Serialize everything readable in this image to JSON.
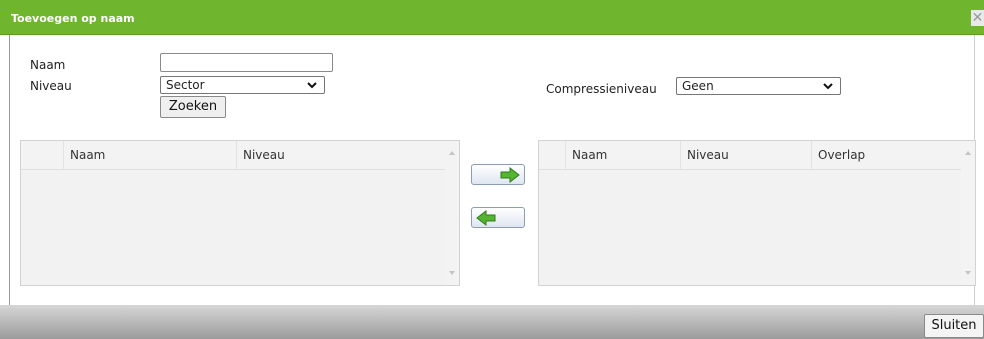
{
  "dialog": {
    "title": "Toevoegen op naam",
    "close_symbol": "✕",
    "close_button_label": "Sluiten"
  },
  "search": {
    "name_label": "Naam",
    "name_value": "",
    "level_label": "Niveau",
    "level_selected": "Sector",
    "search_button_label": "Zoeken"
  },
  "compression": {
    "label": "Compressieniveau",
    "selected": "Geen"
  },
  "source_grid": {
    "columns": [
      "Naam",
      "Niveau"
    ],
    "rows": []
  },
  "target_grid": {
    "columns": [
      "Naam",
      "Niveau",
      "Overlap"
    ],
    "rows": []
  },
  "icons": {
    "add": "arrow-right-icon",
    "remove": "arrow-left-icon",
    "arrow_color": "#55b431"
  },
  "colors": {
    "titlebar": "#6fb52e",
    "footer": "#a8a8a8"
  }
}
